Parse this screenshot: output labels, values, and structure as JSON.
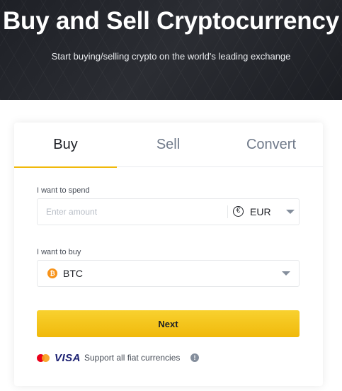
{
  "hero": {
    "title": "Buy and Sell Cryptocurrency",
    "subtitle": "Start buying/selling crypto on the world's leading exchange"
  },
  "tabs": [
    {
      "label": "Buy",
      "active": true
    },
    {
      "label": "Sell",
      "active": false
    },
    {
      "label": "Convert",
      "active": false
    }
  ],
  "spend": {
    "label": "I want to spend",
    "placeholder": "Enter amount",
    "value": "",
    "currency_symbol": "€",
    "currency": "EUR"
  },
  "buy": {
    "label": "I want to buy",
    "coin_symbol": "₿",
    "coin": "BTC"
  },
  "next_label": "Next",
  "footer": {
    "visa": "VISA",
    "support_text": "Support all fiat currencies",
    "info_symbol": "!"
  },
  "colors": {
    "accent": "#f0b90b",
    "hero_bg": "#1e2026",
    "btc": "#f7931a"
  },
  "icons": [
    "euro-icon",
    "chevron-down-icon",
    "bitcoin-icon",
    "mastercard-icon",
    "visa-logo",
    "info-icon"
  ]
}
